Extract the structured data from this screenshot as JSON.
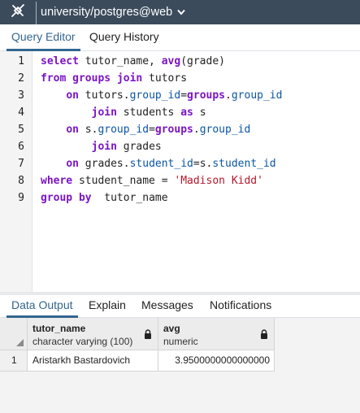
{
  "connection": {
    "label": "university/postgres@web"
  },
  "editor_tabs": [
    {
      "label": "Query Editor",
      "active": true
    },
    {
      "label": "Query History",
      "active": false
    }
  ],
  "editor": {
    "line_numbers": [
      "1",
      "2",
      "3",
      "4",
      "5",
      "6",
      "7",
      "8",
      "9"
    ],
    "lines": [
      [
        {
          "t": "kw",
          "v": "select"
        },
        {
          "t": "op",
          "v": " tutor_name, "
        },
        {
          "t": "kw",
          "v": "avg"
        },
        {
          "t": "op",
          "v": "(grade)"
        }
      ],
      [
        {
          "t": "kw",
          "v": "from"
        },
        {
          "t": "op",
          "v": " "
        },
        {
          "t": "kw",
          "v": "groups"
        },
        {
          "t": "op",
          "v": " "
        },
        {
          "t": "kw",
          "v": "join"
        },
        {
          "t": "op",
          "v": " tutors"
        }
      ],
      [
        {
          "t": "op",
          "v": "    "
        },
        {
          "t": "kw",
          "v": "on"
        },
        {
          "t": "op",
          "v": " tutors."
        },
        {
          "t": "prop",
          "v": "group_id"
        },
        {
          "t": "op",
          "v": "="
        },
        {
          "t": "kw",
          "v": "groups"
        },
        {
          "t": "op",
          "v": "."
        },
        {
          "t": "prop",
          "v": "group_id"
        }
      ],
      [
        {
          "t": "op",
          "v": "        "
        },
        {
          "t": "kw",
          "v": "join"
        },
        {
          "t": "op",
          "v": " students "
        },
        {
          "t": "kw",
          "v": "as"
        },
        {
          "t": "op",
          "v": " s"
        }
      ],
      [
        {
          "t": "op",
          "v": "    "
        },
        {
          "t": "kw",
          "v": "on"
        },
        {
          "t": "op",
          "v": " s."
        },
        {
          "t": "prop",
          "v": "group_id"
        },
        {
          "t": "op",
          "v": "="
        },
        {
          "t": "kw",
          "v": "groups"
        },
        {
          "t": "op",
          "v": "."
        },
        {
          "t": "prop",
          "v": "group_id"
        }
      ],
      [
        {
          "t": "op",
          "v": "        "
        },
        {
          "t": "kw",
          "v": "join"
        },
        {
          "t": "op",
          "v": " grades"
        }
      ],
      [
        {
          "t": "op",
          "v": "    "
        },
        {
          "t": "kw",
          "v": "on"
        },
        {
          "t": "op",
          "v": " grades."
        },
        {
          "t": "prop",
          "v": "student_id"
        },
        {
          "t": "op",
          "v": "=s."
        },
        {
          "t": "prop",
          "v": "student_id"
        }
      ],
      [
        {
          "t": "kw",
          "v": "where"
        },
        {
          "t": "op",
          "v": " student_name = "
        },
        {
          "t": "str",
          "v": "'Madison Kidd'"
        }
      ],
      [
        {
          "t": "kw",
          "v": "group"
        },
        {
          "t": "op",
          "v": " "
        },
        {
          "t": "kw",
          "v": "by"
        },
        {
          "t": "op",
          "v": "  tutor_name"
        }
      ]
    ]
  },
  "result_tabs": [
    {
      "label": "Data Output",
      "active": true
    },
    {
      "label": "Explain",
      "active": false
    },
    {
      "label": "Messages",
      "active": false
    },
    {
      "label": "Notifications",
      "active": false
    }
  ],
  "grid": {
    "columns": [
      {
        "name": "tutor_name",
        "type": "character varying (100)",
        "icon": "lock-icon"
      },
      {
        "name": "avg",
        "type": "numeric",
        "icon": "lock-icon"
      }
    ],
    "rows": [
      {
        "num": "1",
        "cells": [
          "Aristarkh Bastardovich",
          "3.9500000000000000"
        ]
      }
    ]
  },
  "colors": {
    "topbar": "#3b4b5c",
    "accent": "#326690",
    "keyword": "#7a15c4",
    "property": "#0b55a5",
    "string": "#b5172b"
  },
  "icons": {
    "connection": "plug-icon",
    "dropdown": "chevron-down-icon",
    "column_lock": "lock-icon"
  }
}
